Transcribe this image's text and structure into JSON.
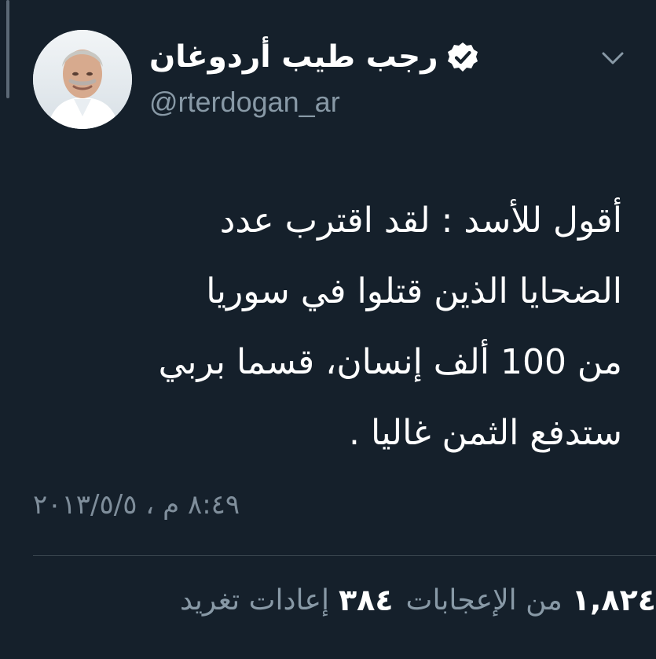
{
  "tweet": {
    "author": {
      "display_name": "رجب طيب أردوغان",
      "handle": "@rterdogan_ar",
      "verified": true,
      "verified_icon": "verified-badge-icon",
      "avatar_icon": "profile-photo"
    },
    "menu_icon": "chevron-down-icon",
    "text_lines": [
      "أقول للأسد : لقد اقترب عدد",
      "الضحايا الذين قتلوا في سوريا",
      "من 100 ألف إنسان، قسما بربي",
      "ستدفع الثمن غاليا ."
    ],
    "timestamp": "٨:٤٩ م ، ٢٠١٣/٥/٥",
    "stats": {
      "retweets_count": "٣٨٤",
      "retweets_label": "إعادات تغريد",
      "likes_count": "١,٨٢٤",
      "likes_label": "من الإعجابات"
    }
  },
  "colors": {
    "background": "#15202b",
    "primary_text": "#ffffff",
    "secondary_text": "#8899a6",
    "divider": "#38444d"
  }
}
